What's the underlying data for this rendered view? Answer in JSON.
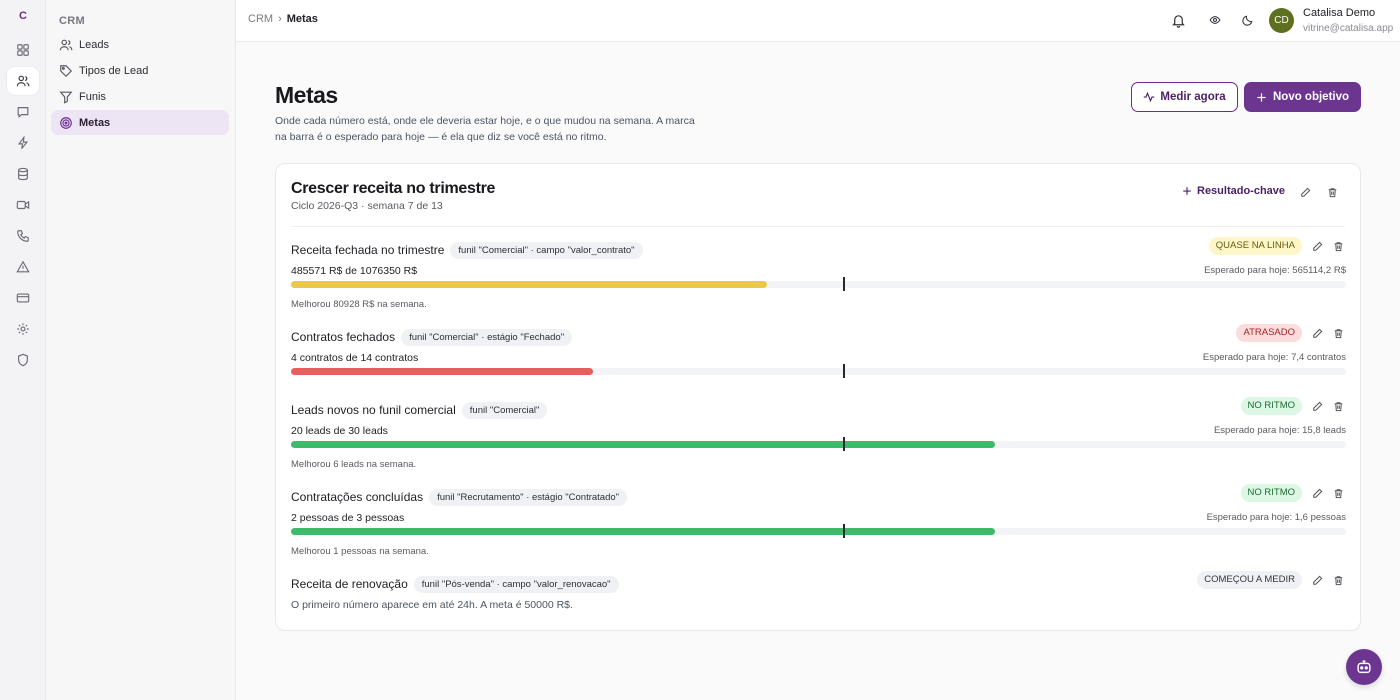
{
  "rail": {
    "logo": "C",
    "icons": [
      "dashboard-icon",
      "users-icon",
      "chat-icon",
      "lightning-icon",
      "database-icon",
      "video-icon",
      "phone-icon",
      "alert-icon",
      "card-icon",
      "settings-icon",
      "shield-icon"
    ]
  },
  "sidenav": {
    "title": "CRM",
    "items": [
      {
        "label": "Leads",
        "icon": "users-icon"
      },
      {
        "label": "Tipos de Lead",
        "icon": "tag-icon"
      },
      {
        "label": "Funis",
        "icon": "filter-icon"
      },
      {
        "label": "Metas",
        "icon": "target-icon",
        "active": true
      }
    ]
  },
  "topbar": {
    "breadcrumb": {
      "root": "CRM",
      "separator": "›",
      "current": "Metas"
    },
    "user": {
      "initials": "CD",
      "name": "Catalisa Demo",
      "email": "vitrine@catalisa.app",
      "avatar_color": "#5f6f20"
    }
  },
  "header": {
    "title": "Metas",
    "description": "Onde cada número está, onde ele deveria estar hoje, e o que mudou na semana. A marca na barra é o esperado para hoje — é ela que diz se você está no ritmo.",
    "measure_button": "Medir agora",
    "new_button": "Novo objetivo"
  },
  "objective": {
    "title": "Crescer receita no trimestre",
    "subtitle": "Ciclo 2026-Q3 · semana 7 de 13",
    "add_kr_label": "Resultado-chave",
    "expected_fraction": 0.524,
    "key_results": [
      {
        "name": "Receita fechada no trimestre",
        "tag": "funil \"Comercial\" · campo \"valor_contrato\"",
        "status": "QUASE NA LINHA",
        "status_color": "yellow",
        "value_text": "485571 R$ de 1076350 R$",
        "expected_text": "Esperado para hoje: 565114,2 R$",
        "progress": 0.451,
        "bar_color": "#e9c84b",
        "note": "Melhorou 80928 R$ na semana."
      },
      {
        "name": "Contratos fechados",
        "tag": "funil \"Comercial\" · estágio \"Fechado\"",
        "status": "ATRASADO",
        "status_color": "red",
        "value_text": "4 contratos de 14 contratos",
        "expected_text": "Esperado para hoje: 7,4 contratos",
        "progress": 0.286,
        "bar_color": "#e85d5d",
        "note": ""
      },
      {
        "name": "Leads novos no funil comercial",
        "tag": "funil \"Comercial\"",
        "status": "NO RITMO",
        "status_color": "green",
        "value_text": "20 leads de 30 leads",
        "expected_text": "Esperado para hoje: 15,8 leads",
        "progress": 0.667,
        "bar_color": "#3dbb6b",
        "note": "Melhorou 6 leads na semana."
      },
      {
        "name": "Contratações concluídas",
        "tag": "funil \"Recrutamento\" · estágio \"Contratado\"",
        "status": "NO RITMO",
        "status_color": "green",
        "value_text": "2 pessoas de 3 pessoas",
        "expected_text": "Esperado para hoje: 1,6 pessoas",
        "progress": 0.667,
        "bar_color": "#3dbb6b",
        "note": "Melhorou 1 pessoas na semana."
      },
      {
        "name": "Receita de renovação",
        "tag": "funil \"Pós-venda\" · campo \"valor_renovacao\"",
        "status": "COMEÇOU A MEDIR",
        "status_color": "grey",
        "pending_text": "O primeiro número aparece em até 24h. A meta é 50000 R$."
      }
    ]
  }
}
